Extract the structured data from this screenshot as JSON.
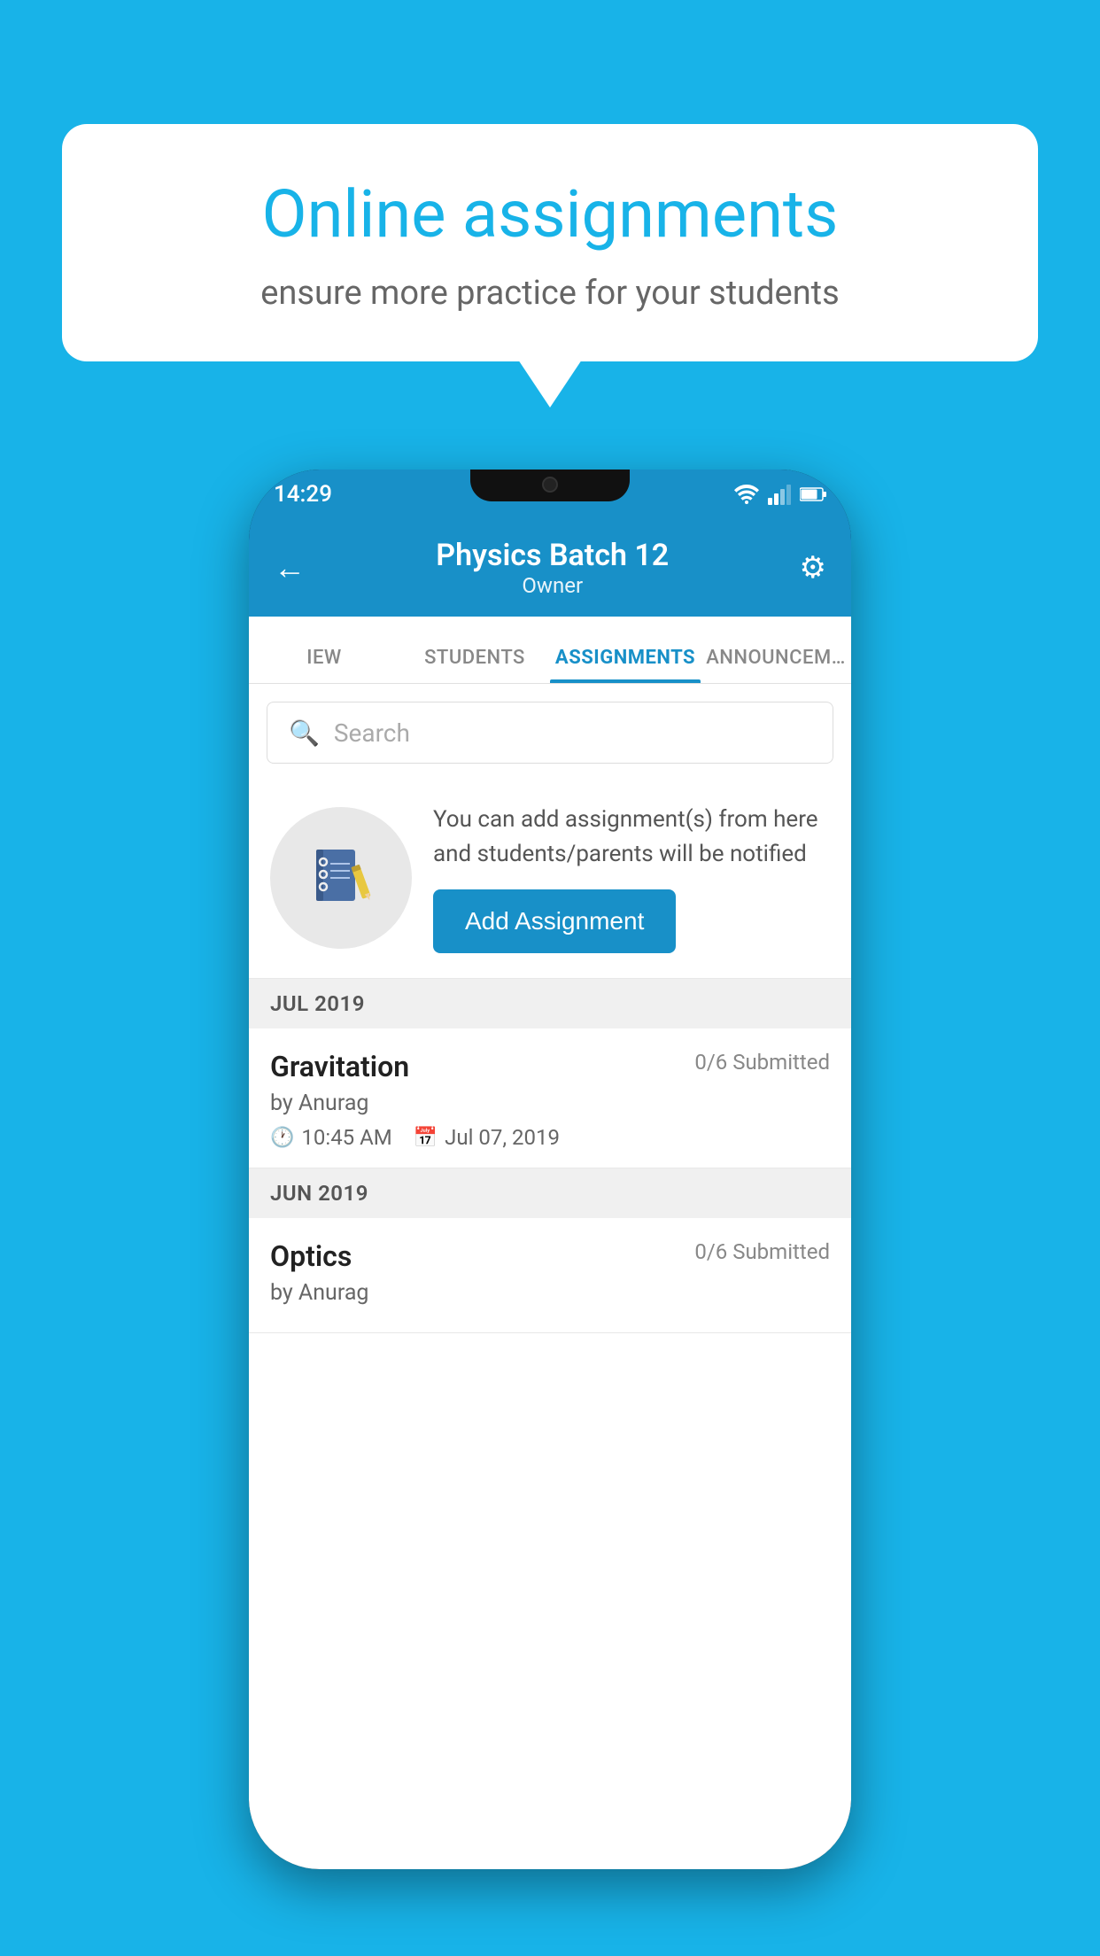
{
  "background_color": "#18b3e8",
  "speech_bubble": {
    "title": "Online assignments",
    "subtitle": "ensure more practice for your students"
  },
  "phone": {
    "status_bar": {
      "time": "14:29"
    },
    "app_bar": {
      "title": "Physics Batch 12",
      "subtitle": "Owner",
      "back_label": "←",
      "settings_label": "⚙"
    },
    "tabs": [
      {
        "label": "IEW",
        "active": false
      },
      {
        "label": "STUDENTS",
        "active": false
      },
      {
        "label": "ASSIGNMENTS",
        "active": true
      },
      {
        "label": "ANNOUNCEM…",
        "active": false
      }
    ],
    "search": {
      "placeholder": "Search"
    },
    "info_card": {
      "description": "You can add assignment(s) from here and students/parents will be notified",
      "button_label": "Add Assignment"
    },
    "sections": [
      {
        "header": "JUL 2019",
        "assignments": [
          {
            "title": "Gravitation",
            "submitted": "0/6 Submitted",
            "author": "by Anurag",
            "time": "10:45 AM",
            "date": "Jul 07, 2019"
          }
        ]
      },
      {
        "header": "JUN 2019",
        "assignments": [
          {
            "title": "Optics",
            "submitted": "0/6 Submitted",
            "author": "by Anurag",
            "time": "",
            "date": ""
          }
        ]
      }
    ]
  }
}
